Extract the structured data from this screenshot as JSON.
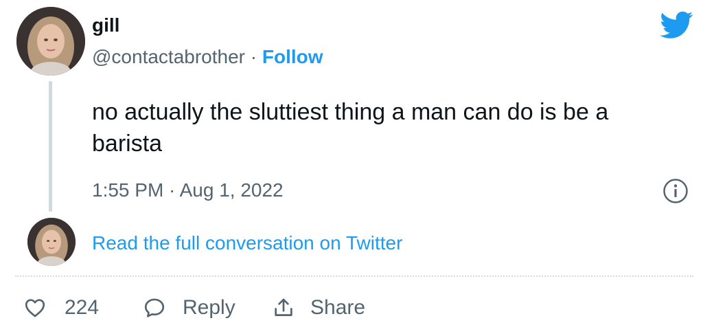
{
  "author": {
    "name": "gill",
    "handle": "@contactabrother",
    "separator": " · ",
    "follow_label": "Follow"
  },
  "tweet": {
    "text": "no actually the sluttiest thing a man can do is be a barista",
    "timestamp": "1:55 PM · Aug 1, 2022"
  },
  "thread": {
    "read_full_label": "Read the full conversation on Twitter"
  },
  "actions": {
    "like_count": "224",
    "reply_label": "Reply",
    "share_label": "Share"
  },
  "icons": {
    "brand": "twitter-bird-icon",
    "info": "info-icon",
    "like": "heart-icon",
    "reply": "speech-bubble-icon",
    "share": "share-icon"
  },
  "colors": {
    "brand_blue": "#1d9bf0",
    "secondary_text": "#536471",
    "primary_text": "#0f1419",
    "thread_line": "#cfd9de"
  }
}
